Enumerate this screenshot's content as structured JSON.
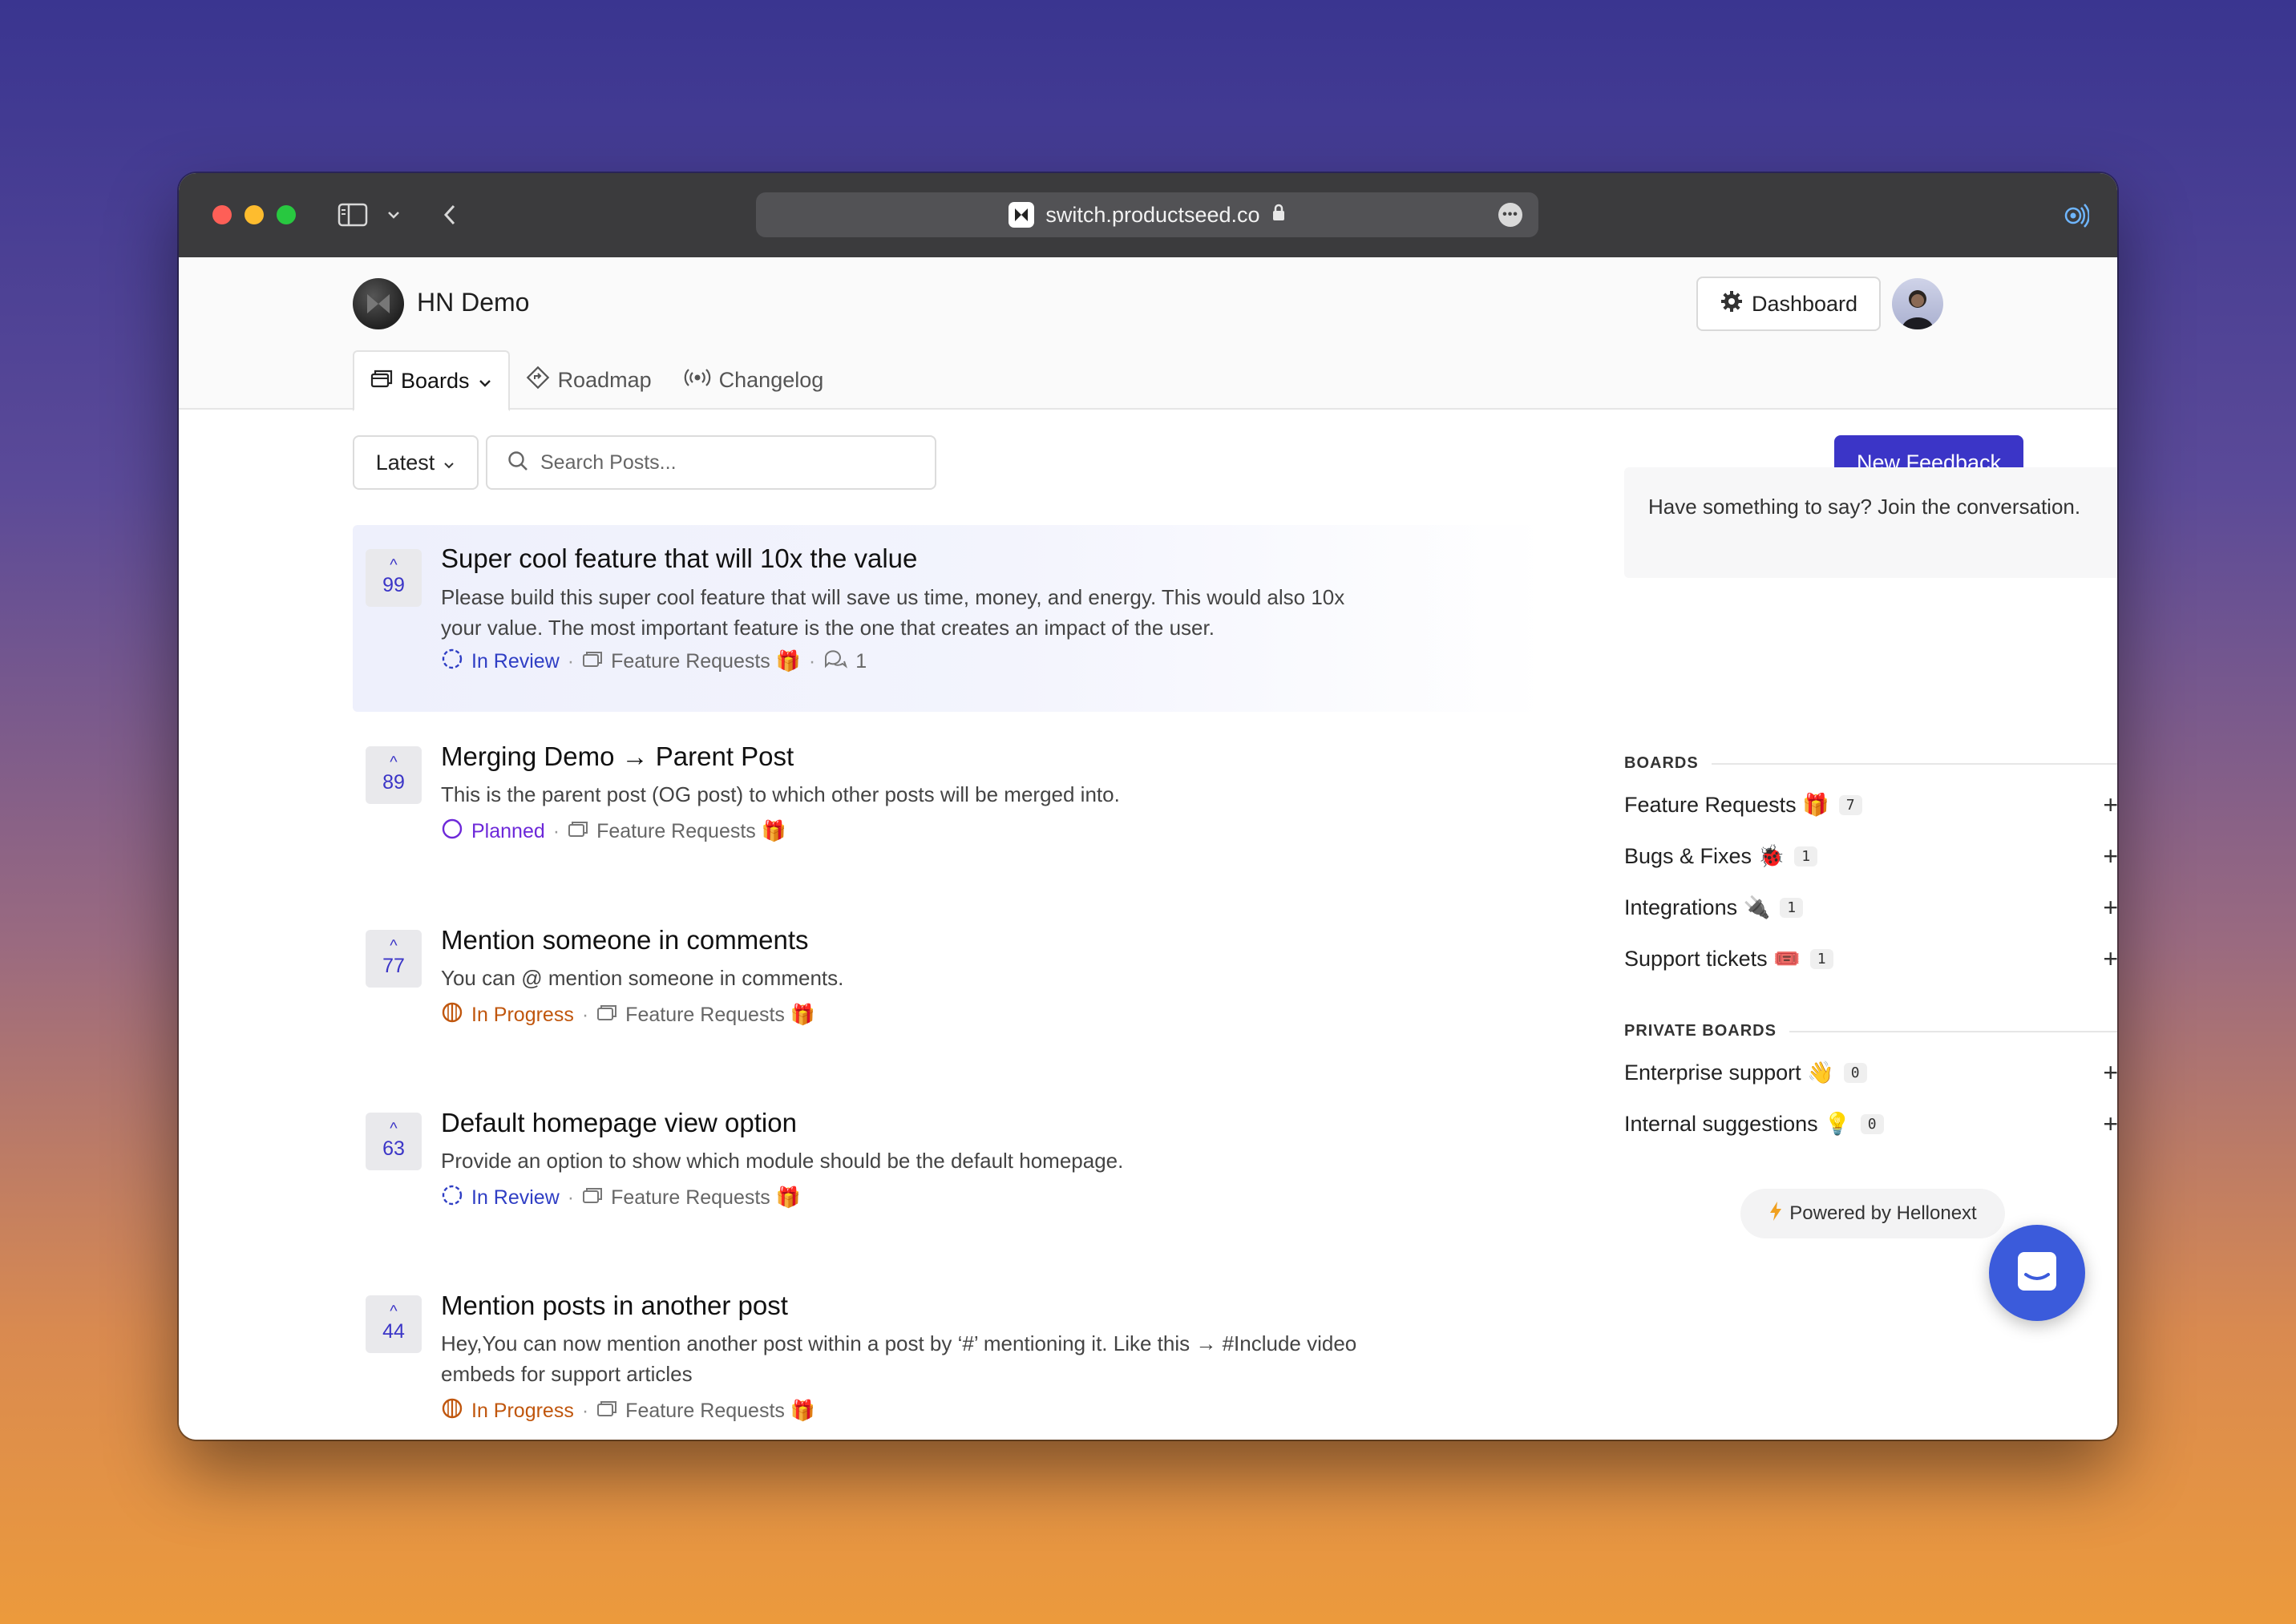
{
  "browser": {
    "url": "switch.productseed.co"
  },
  "header": {
    "brand_name": "HN Demo",
    "dashboard_label": "Dashboard",
    "tabs": [
      {
        "label": "Boards",
        "icon": "boards-icon"
      },
      {
        "label": "Roadmap",
        "icon": "roadmap-icon"
      },
      {
        "label": "Changelog",
        "icon": "changelog-icon"
      }
    ]
  },
  "toolbar": {
    "sort_label": "Latest",
    "search_placeholder": "Search Posts...",
    "new_feedback_label": "New Feedback"
  },
  "posts": [
    {
      "votes": "99",
      "title": "Super cool feature that will 10x the value",
      "description": "Please build this super cool feature that will save us time, money, and energy. This would also 10x your value. The most important feature is the one that creates an impact of the user.",
      "status": "In Review",
      "board": "Feature Requests 🎁",
      "comments": "1"
    },
    {
      "votes": "89",
      "title": "Merging Demo → Parent Post",
      "description": "This is the parent post (OG post) to which other posts will be merged into.",
      "status": "Planned",
      "board": "Feature Requests 🎁"
    },
    {
      "votes": "77",
      "title": "Mention someone in comments",
      "description": "You can @ mention someone in comments.",
      "status": "In Progress",
      "board": "Feature Requests 🎁"
    },
    {
      "votes": "63",
      "title": "Default homepage view option",
      "description": "Provide an option to show which module should be the default homepage.",
      "status": "In Review",
      "board": "Feature Requests 🎁"
    },
    {
      "votes": "44",
      "title": "Mention posts in another post",
      "description": "Hey,You can now mention another post within a post by ‘#’ mentioning it. Like this → #Include video embeds for support articles",
      "status": "In Progress",
      "board": "Feature Requests 🎁"
    }
  ],
  "sidebar": {
    "join_text": "Have something to say? Join the conversation.",
    "boards_heading": "BOARDS",
    "boards": [
      {
        "label": "Feature Requests 🎁",
        "count": "7"
      },
      {
        "label": "Bugs & Fixes 🐞",
        "count": "1"
      },
      {
        "label": "Integrations 🔌",
        "count": "1"
      },
      {
        "label": "Support tickets 🎟️",
        "count": "1"
      }
    ],
    "private_heading": "PRIVATE BOARDS",
    "private_boards": [
      {
        "label": "Enterprise support 👋",
        "count": "0"
      },
      {
        "label": "Internal suggestions 💡",
        "count": "0"
      }
    ],
    "powered_by": "Powered by Hellonext"
  },
  "colors": {
    "accent": "#3b35c7",
    "in_review": "#2f3ec4",
    "planned": "#6d28d9",
    "in_progress": "#c0560d",
    "chat": "#3b5bdb"
  }
}
